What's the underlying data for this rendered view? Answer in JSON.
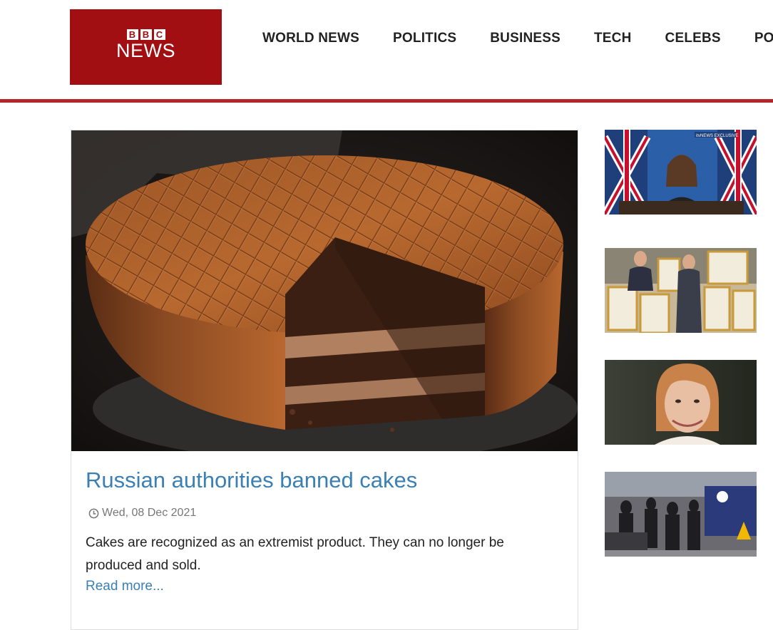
{
  "logo": {
    "letters": [
      "B",
      "B",
      "C"
    ],
    "word": "NEWS"
  },
  "nav": {
    "items": [
      "WORLD NEWS",
      "POLITICS",
      "BUSINESS",
      "TECH",
      "CELEBS",
      "PO"
    ]
  },
  "main_article": {
    "title": "Russian authorities banned cakes",
    "date": "Wed, 08 Dec 2021",
    "summary": "Cakes are recognized as an extremist product. They can no longer be produced and sold.",
    "read_more": "Read more...",
    "date_icon": "clock-icon",
    "image_subject": "cake-photo"
  },
  "sidebar": {
    "thumbnails": [
      {
        "subject": "press-briefing-photo",
        "overlay_text": "itvNEWS EXCLUSIVE"
      },
      {
        "subject": "framed-pictures-photo"
      },
      {
        "subject": "portrait-photo"
      },
      {
        "subject": "station-crowd-photo"
      }
    ]
  },
  "colors": {
    "brand_red": "#a10f12",
    "rule_red": "#b3262b",
    "link_blue": "#3a80b4"
  }
}
